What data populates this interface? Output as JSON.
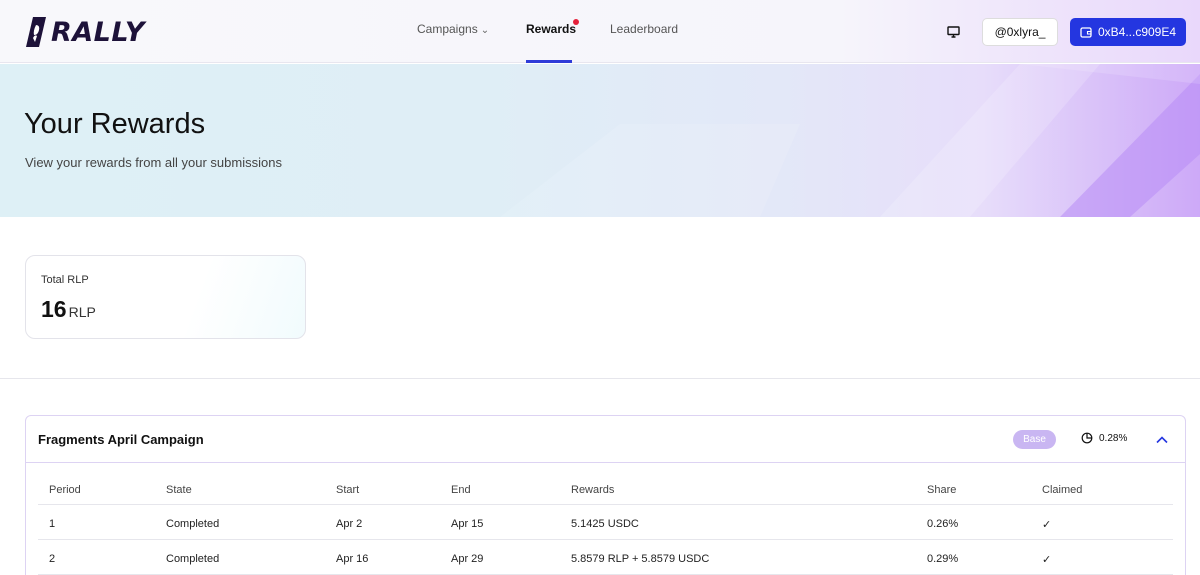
{
  "brand": {
    "logo_text": "RALLY"
  },
  "nav": {
    "links": [
      {
        "label": "Campaigns",
        "has_dropdown": true
      },
      {
        "label": "Rewards",
        "active": true,
        "notification": true
      },
      {
        "label": "Leaderboard"
      }
    ],
    "user_handle": "@0xlyra_",
    "wallet_address": "0xB4...c909E4"
  },
  "hero": {
    "title": "Your Rewards",
    "subtitle": "View your rewards from all your submissions"
  },
  "total": {
    "label": "Total RLP",
    "value": "16",
    "unit": "RLP"
  },
  "campaign": {
    "title": "Fragments April Campaign",
    "badge": "Base",
    "share": "0.28%",
    "columns": [
      "Period",
      "State",
      "Start",
      "End",
      "Rewards",
      "Share",
      "Claimed"
    ],
    "rows": [
      {
        "period": "1",
        "state": "Completed",
        "start": "Apr 2",
        "end": "Apr 15",
        "rewards": "5.1425 USDC",
        "share": "0.26%",
        "claimed": "✓"
      },
      {
        "period": "2",
        "state": "Completed",
        "start": "Apr 16",
        "end": "Apr 29",
        "rewards": "5.8579 RLP + 5.8579 USDC",
        "share": "0.29%",
        "claimed": "✓"
      }
    ]
  },
  "colors": {
    "primary": "#2436e0",
    "badge": "#c9b6f2",
    "notification": "#e5203a",
    "logo": "#1d1239"
  }
}
